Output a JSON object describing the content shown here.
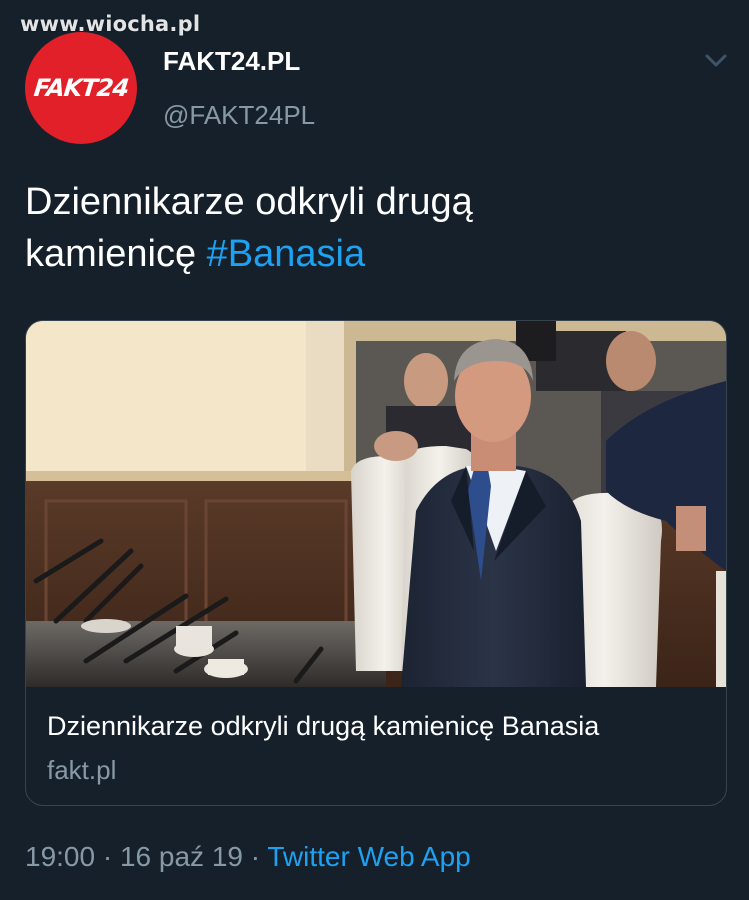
{
  "watermark": "www.wiocha.pl",
  "avatar": {
    "text": "FAKT24",
    "color": "#e2202a"
  },
  "author": {
    "display_name": "FAKT24.PL",
    "handle": "@FAKT24PL"
  },
  "menu_icon": "chevron-down-icon",
  "tweet": {
    "text_part1": "Dziennikarze odkryli drugą",
    "text_part2": "kamienicę ",
    "hashtag": "#Banasia"
  },
  "card": {
    "title": "Dziennikarze odkryli drugą kamienicę Banasia",
    "domain": "fakt.pl"
  },
  "meta": {
    "time": "19:00",
    "separator1": " · ",
    "date": "16 paź 19",
    "separator2": " · ",
    "source": "Twitter Web App"
  },
  "colors": {
    "background": "#15202b",
    "accent": "#1da1f2",
    "secondary_text": "#8899a6",
    "border": "#38444d"
  }
}
